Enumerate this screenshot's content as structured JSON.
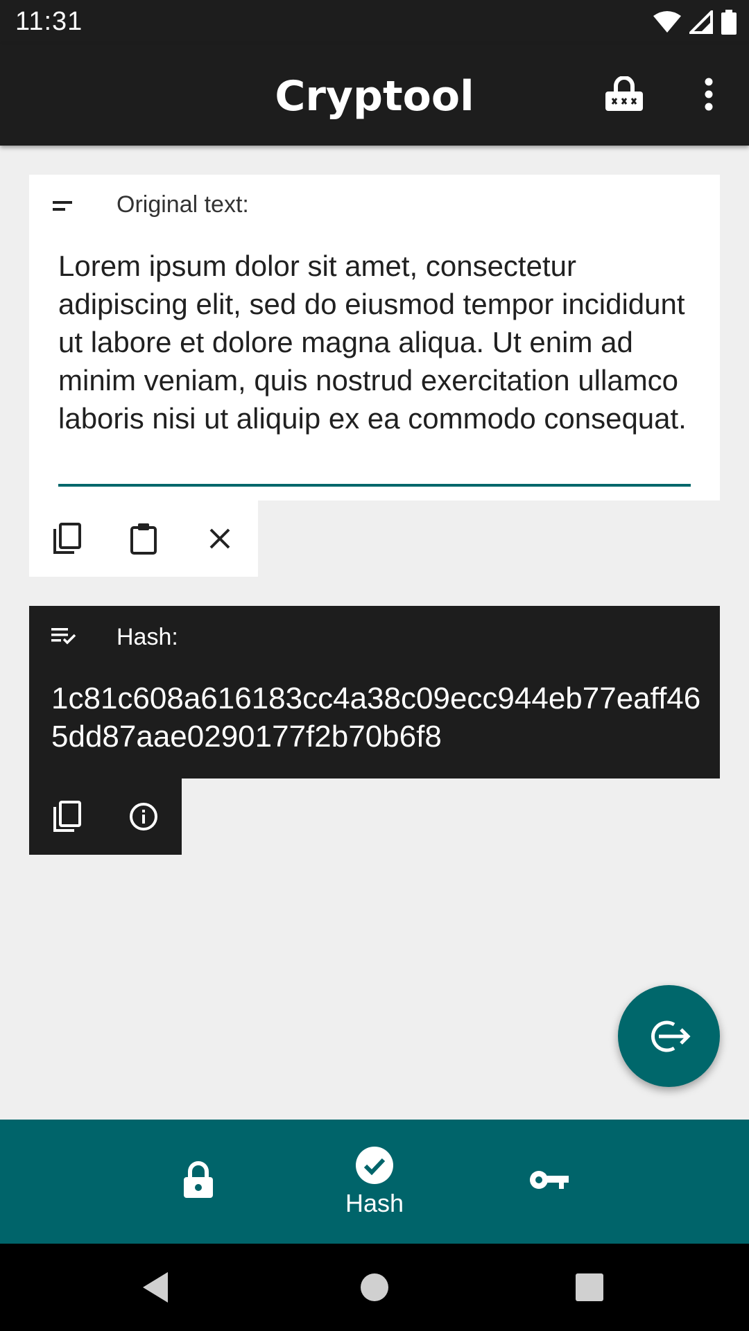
{
  "status_bar": {
    "time": "11:31"
  },
  "app_bar": {
    "title": "Cryptool",
    "actions": [
      "password-generator-icon",
      "more-vert-icon"
    ]
  },
  "original_card": {
    "label": "Original text:",
    "value": "Lorem ipsum dolor sit amet, consectetur adipiscing elit, sed do eiusmod tempor incididunt ut labore et dolore magna aliqua. Ut enim ad minim veniam, quis nostrud exercitation ullamco laboris nisi ut aliquip ex ea commodo consequat.",
    "tools": [
      "copy-icon",
      "paste-icon",
      "clear-icon"
    ]
  },
  "hash_card": {
    "label": "Hash:",
    "value": "1c81c608a616183cc4a38c09ecc944eb77eaff465dd87aae0290177f2b70b6f8",
    "tools": [
      "copy-icon",
      "info-icon"
    ]
  },
  "fab": {
    "icon": "export-icon"
  },
  "bottom_nav": {
    "items": [
      {
        "icon": "lock-icon",
        "label": ""
      },
      {
        "icon": "check-circle-icon",
        "label": "Hash",
        "selected": true
      },
      {
        "icon": "key-icon",
        "label": ""
      }
    ]
  },
  "colors": {
    "accent": "#00676b",
    "dark": "#1d1d1d",
    "background": "#efefef"
  }
}
